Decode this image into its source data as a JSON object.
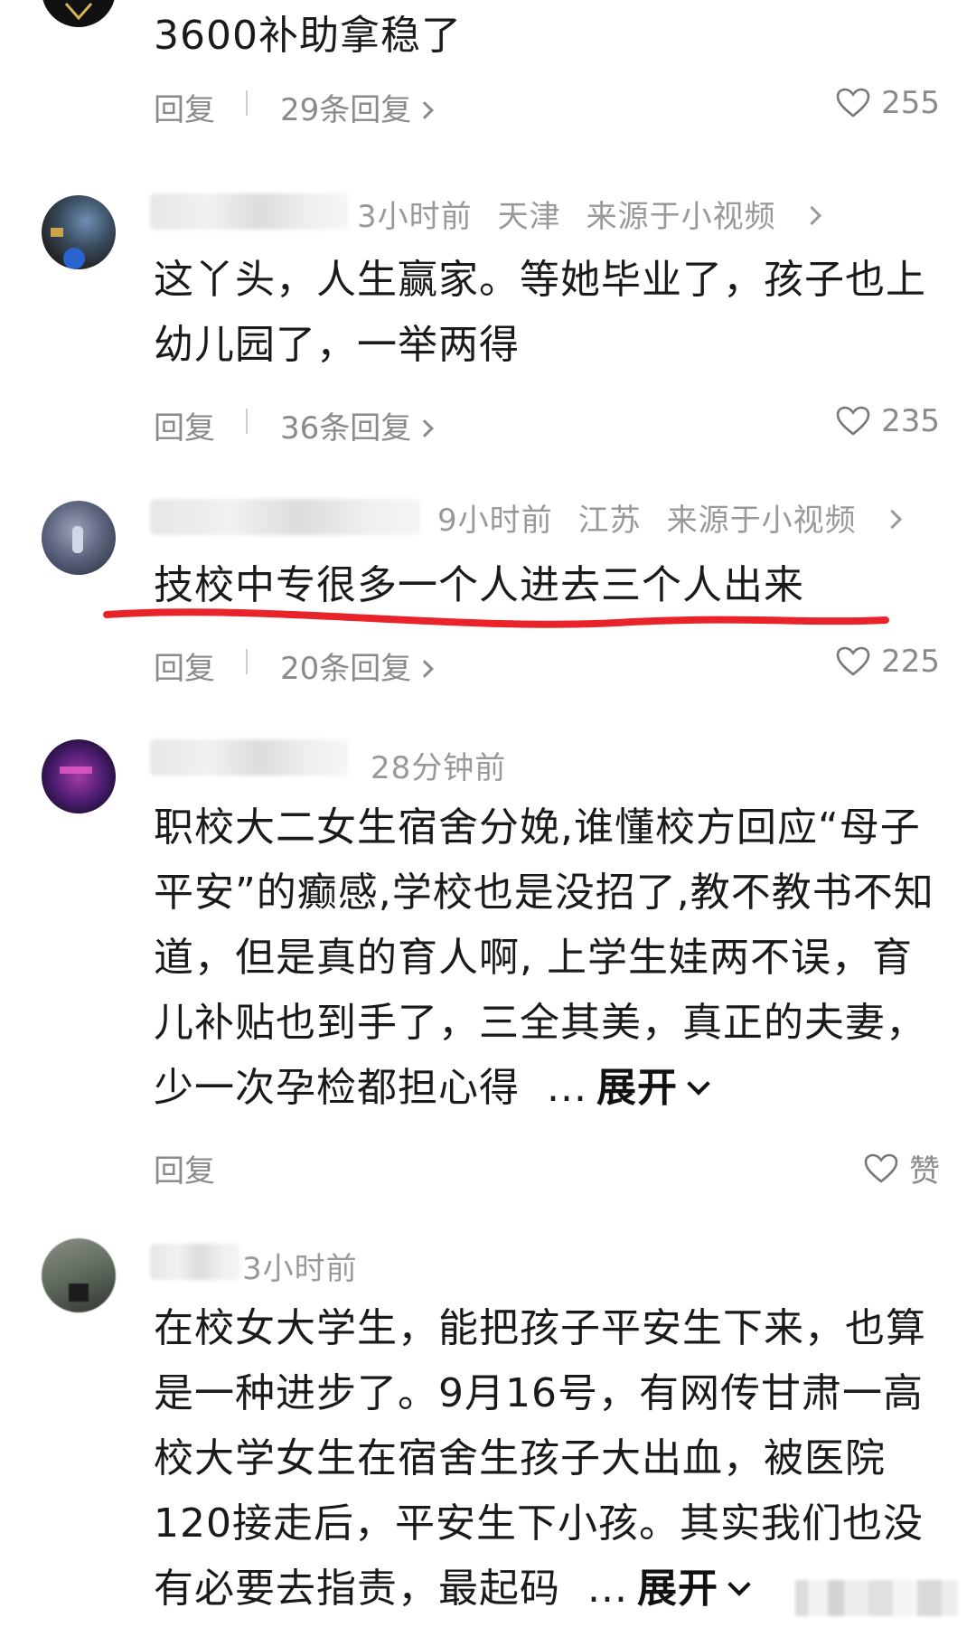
{
  "comments": [
    {
      "text": "3600补助拿稳了",
      "reply_label": "回复",
      "reply_count": "29条回复",
      "like_count": "255"
    },
    {
      "time": "3小时前",
      "location": "天津",
      "source": "来源于小视频",
      "text": "这丫头，人生赢家。等她毕业了，孩子也上幼儿园了，一举两得",
      "reply_label": "回复",
      "reply_count": "36条回复",
      "like_count": "235"
    },
    {
      "time": "9小时前",
      "location": "江苏",
      "source": "来源于小视频",
      "text": "技校中专很多一个人进去三个人出来",
      "reply_label": "回复",
      "reply_count": "20条回复",
      "like_count": "225",
      "highlight_color": "#e8232a"
    },
    {
      "time": "28分钟前",
      "text": "职校大二女生宿舍分娩,谁懂校方回应“母子平安”的癫感,学校也是没招了,教不教书不知道，但是真的育人啊, 上学生娃两不误，育儿补贴也到手了，三全其美，真正的夫妻，少一次孕检都担心得",
      "ellipsis": "...",
      "expand_label": "展开",
      "reply_label": "回复",
      "like_label": "赞"
    },
    {
      "time": "3小时前",
      "text": "在校女大学生，能把孩子平安生下来，也算是一种进步了。9月16号，有网传甘肃一高校大学女生在宿舍生孩子大出血，被医院120接走后，平安生下小孩。其实我们也没有必要去指责，最起码",
      "ellipsis": "...",
      "expand_label": "展开"
    }
  ]
}
